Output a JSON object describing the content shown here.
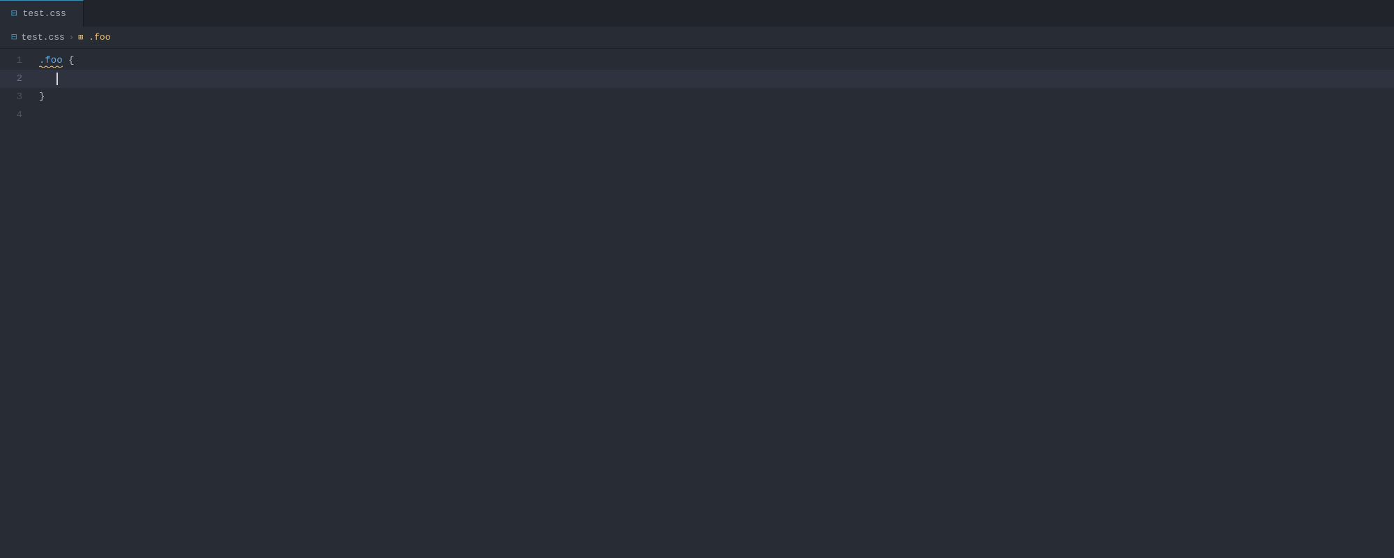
{
  "tab": {
    "icon": "⊟",
    "label": "test.css"
  },
  "breadcrumb": {
    "file_icon": "⊟",
    "file_label": "test.css",
    "separator": "›",
    "selector_icon": "⊞",
    "selector_label": ".foo"
  },
  "editor": {
    "lines": [
      {
        "number": "1",
        "active": false,
        "content_type": "selector",
        "selector": ".foo",
        "brace": " {"
      },
      {
        "number": "2",
        "active": true,
        "content_type": "cursor",
        "indent": true
      },
      {
        "number": "3",
        "active": false,
        "content_type": "closing",
        "brace": "}"
      },
      {
        "number": "4",
        "active": false,
        "content_type": "empty"
      }
    ]
  },
  "colors": {
    "bg": "#282c34",
    "tab_active_bg": "#282c34",
    "tab_inactive_bg": "#21252b",
    "accent": "#3a8fb5",
    "line_active": "#2f3340",
    "selector_color": "#61afef",
    "brace_color": "#c678dd",
    "squiggly_color": "#e5c07b",
    "line_number_inactive": "#4b5263",
    "line_number_active": "#636d83"
  }
}
